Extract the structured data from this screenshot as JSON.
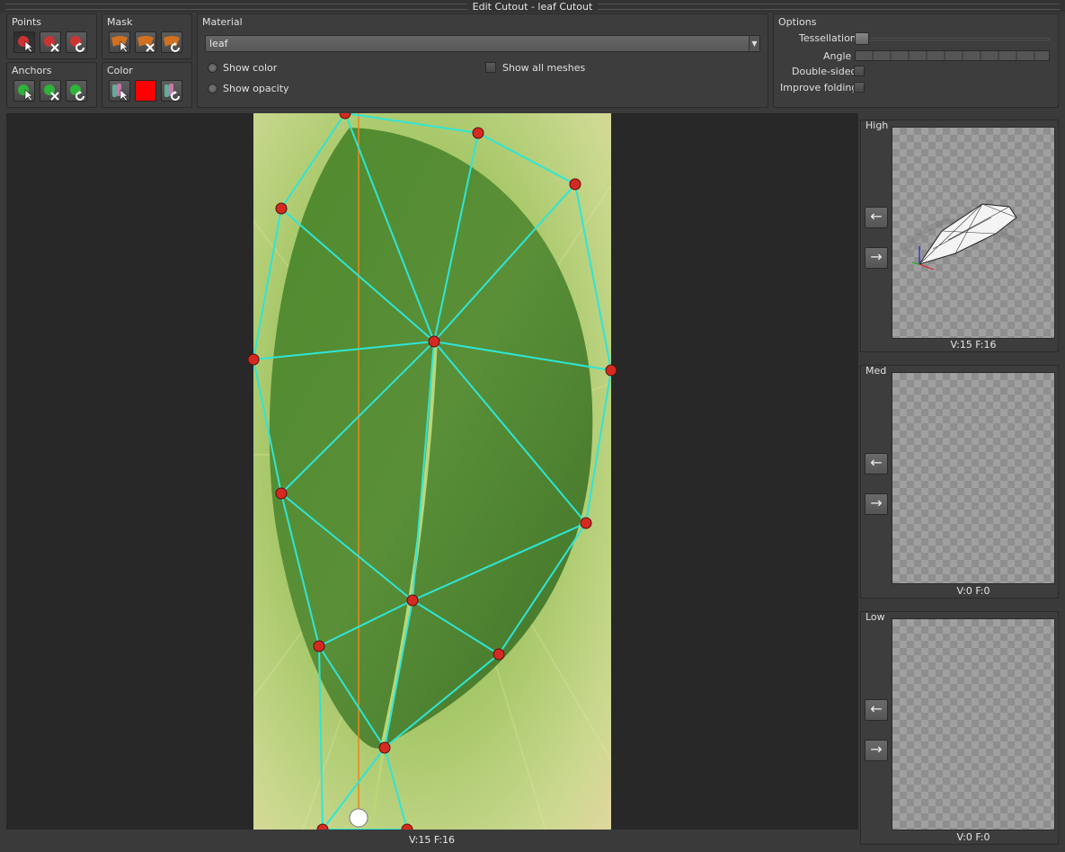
{
  "window": {
    "title": "Edit Cutout - leaf Cutout"
  },
  "points": {
    "label": "Points"
  },
  "mask": {
    "label": "Mask"
  },
  "anchors": {
    "label": "Anchors"
  },
  "color": {
    "label": "Color",
    "swatch": "#ff0000"
  },
  "material": {
    "label": "Material",
    "selected": "leaf",
    "show_color": "Show color",
    "show_opacity": "Show opacity",
    "show_all_meshes": "Show all  meshes"
  },
  "options": {
    "label": "Options",
    "tessellation": "Tessellation",
    "angle": "Angle",
    "double_sided": "Double-sided",
    "improve_folding": "Improve folding"
  },
  "canvas": {
    "status": "V:15  F:16"
  },
  "lod": [
    {
      "label": "High",
      "count": "V:15  F:16"
    },
    {
      "label": "Med",
      "count": "V:0  F:0"
    },
    {
      "label": "Low",
      "count": "V:0  F:0"
    }
  ],
  "colors": {
    "mesh_line": "#2ee6d6",
    "vertex": "#d42a22",
    "axis_line": "#e88a1c",
    "pivot": "#ffffff"
  }
}
